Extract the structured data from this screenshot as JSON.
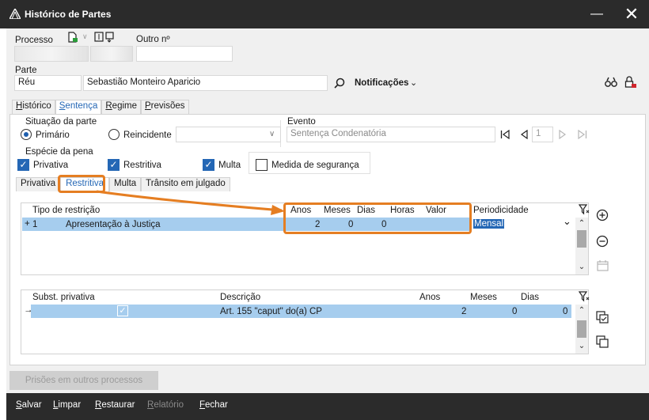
{
  "window": {
    "title": "Histórico de Partes",
    "minimize": "—",
    "close": "✕"
  },
  "header": {
    "processo_label": "Processo",
    "outro_label": "Outro nº",
    "parte_label": "Parte",
    "parte_tipo": "Réu",
    "parte_nome": "Sebastião Monteiro Aparicio",
    "notificacoes_label": "Notificações"
  },
  "tabs": [
    {
      "label": "Histórico",
      "active": false
    },
    {
      "label": "Sentença",
      "active": true
    },
    {
      "label": "Regime",
      "active": false
    },
    {
      "label": "Previsões",
      "active": false
    }
  ],
  "situacao": {
    "title": "Situação da parte",
    "primario": "Primário",
    "reincidente": "Reincidente",
    "selected": "Primário"
  },
  "evento": {
    "label": "Evento",
    "placeholder": "Sentença Condenatória",
    "page": "1"
  },
  "especie": {
    "title": "Espécie da pena",
    "items": [
      {
        "label": "Privativa",
        "checked": true
      },
      {
        "label": "Restritiva",
        "checked": true
      },
      {
        "label": "Multa",
        "checked": true
      },
      {
        "label": "Medida de segurança",
        "checked": false
      }
    ]
  },
  "subtabs": [
    {
      "label": "Privativa",
      "active": false
    },
    {
      "label": "Restritiva",
      "active": true
    },
    {
      "label": "Multa",
      "active": false
    },
    {
      "label": "Trânsito em julgado",
      "active": false
    }
  ],
  "restricao_grid": {
    "headers": {
      "tipo": "Tipo de restrição",
      "anos": "Anos",
      "meses": "Meses",
      "dias": "Dias",
      "horas": "Horas",
      "valor": "Valor",
      "periodicidade": "Periodicidade"
    },
    "rows": [
      {
        "marker": "+",
        "num": "1",
        "tipo": "Apresentação à Justiça",
        "anos": "2",
        "meses": "0",
        "dias": "0",
        "horas": "",
        "valor": "",
        "periodicidade": "Mensal"
      }
    ]
  },
  "subst_grid": {
    "headers": {
      "subst": "Subst. privativa",
      "descricao": "Descrição",
      "anos": "Anos",
      "meses": "Meses",
      "dias": "Dias"
    },
    "rows": [
      {
        "marker": "→",
        "checked": true,
        "descricao": "Art. 155 \"caput\" do(a) CP",
        "anos": "2",
        "meses": "0",
        "dias": "0"
      }
    ]
  },
  "prisoes_button": "Prisões em outros processos",
  "footer": {
    "salvar": "Salvar",
    "limpar": "Limpar",
    "restaurar": "Restaurar",
    "relatorio": "Relatório",
    "fechar": "Fechar"
  },
  "colors": {
    "accent": "#2467b5",
    "highlight": "#a6cdee",
    "annotation": "#e57e22",
    "titlebar": "#2b2b2b"
  }
}
